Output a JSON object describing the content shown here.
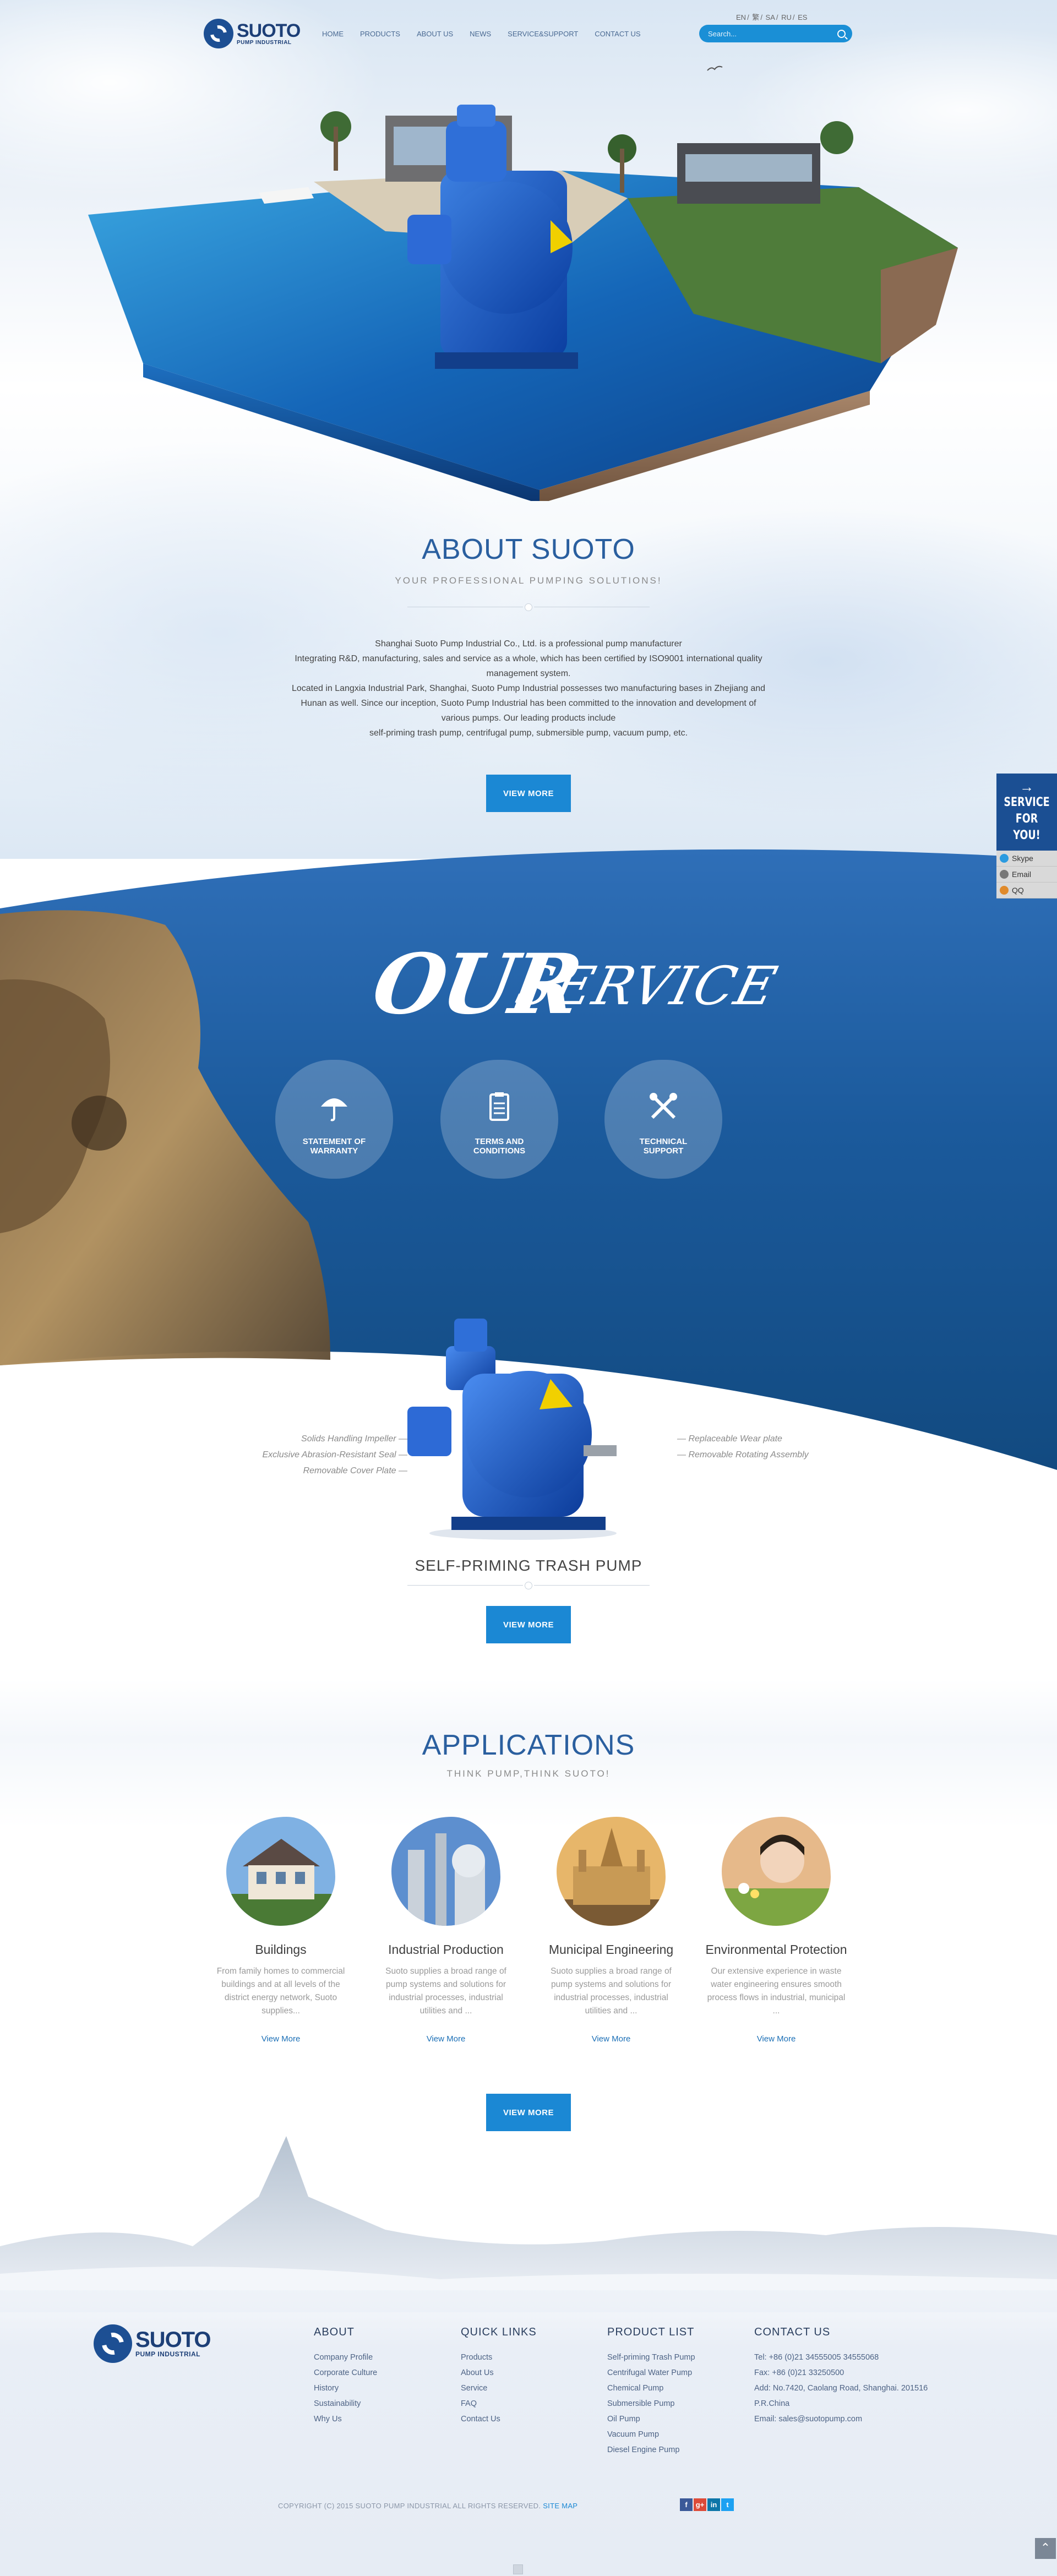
{
  "header": {
    "logo_main": "SUOTO",
    "logo_sub": "PUMP INDUSTRIAL",
    "nav": [
      "HOME",
      "PRODUCTS",
      "ABOUT US",
      "NEWS",
      "SERVICE&SUPPORT",
      "CONTACT US"
    ],
    "languages": [
      "EN",
      "繁",
      "SA",
      "RU",
      "ES"
    ],
    "search_placeholder": "Search..."
  },
  "about": {
    "title": "ABOUT SUOTO",
    "subtitle": "YOUR PROFESSIONAL PUMPING SOLUTIONS!",
    "lines": [
      "Shanghai Suoto Pump Industrial Co., Ltd. is a professional pump manufacturer",
      "Integrating R&D, manufacturing, sales and service as a whole, which has been certified by ISO9001 international quality",
      "management system.",
      "Located in Langxia Industrial Park, Shanghai, Suoto Pump Industrial possesses two manufacturing bases in Zhejiang and",
      "Hunan as well. Since our inception, Suoto Pump Industrial has been committed to the innovation and development of",
      "various pumps. Our leading products include",
      "self-priming trash pump, centrifugal pump, submersible pump,  vacuum pump, etc."
    ],
    "button": "VIEW MORE"
  },
  "service": {
    "title_our": "OUR",
    "title_service": "SERVICE",
    "items": [
      {
        "icon": "umbrella-icon",
        "line1": "STATEMENT OF",
        "line2": "WARRANTY"
      },
      {
        "icon": "clipboard-icon",
        "line1": "TERMS AND",
        "line2": "CONDITIONS"
      },
      {
        "icon": "tools-icon",
        "line1": "TECHNICAL",
        "line2": "SUPPORT"
      }
    ]
  },
  "side_panel": {
    "arrow": "→",
    "line1": "SERVICE",
    "line2": "FOR YOU!",
    "items": [
      {
        "label": "Skype",
        "icon": "skype-icon",
        "color": "#2b9be0"
      },
      {
        "label": "Email",
        "icon": "email-icon",
        "color": "#777777"
      },
      {
        "label": "QQ",
        "icon": "qq-icon",
        "color": "#e08a2b"
      }
    ]
  },
  "product": {
    "features_left": [
      "Solids Handling Impeller",
      "Exclusive Abrasion-Resistant Seal",
      "Removable Cover Plate"
    ],
    "features_right": [
      "Replaceable Wear plate",
      "Removable Rotating Assembly"
    ],
    "title": "SELF-PRIMING TRASH PUMP",
    "button": "VIEW MORE"
  },
  "applications": {
    "title": "APPLICATIONS",
    "subtitle": "THINK PUMP,THINK SUOTO!",
    "items": [
      {
        "name": "Buildings",
        "desc": [
          "From family homes to commercial",
          "buildings and at all levels of the",
          "district energy network, Suoto",
          "supplies..."
        ],
        "more": "View More"
      },
      {
        "name": "Industrial Production",
        "desc": [
          "Suoto supplies a broad range of",
          "pump systems and solutions for",
          "industrial processes, industrial",
          "utilities and ..."
        ],
        "more": "View More"
      },
      {
        "name": "Municipal Engineering",
        "desc": [
          "Suoto supplies a broad range of",
          "pump systems and solutions for",
          "industrial processes, industrial",
          "utilities and ..."
        ],
        "more": "View More"
      },
      {
        "name": "Environmental Protection",
        "desc": [
          "Our extensive experience in waste",
          "water engineering ensures smooth",
          "process flows in industrial, municipal",
          "..."
        ],
        "more": "View More"
      }
    ],
    "button": "VIEW MORE"
  },
  "footer": {
    "logo_main": "SUOTO",
    "logo_sub": "PUMP INDUSTRIAL",
    "about": {
      "heading": "ABOUT",
      "items": [
        "Company Profile",
        "Corporate Culture",
        "History",
        "Sustainability",
        "Why Us"
      ]
    },
    "quick_links": {
      "heading": "QUICK LINKS",
      "items": [
        "Products",
        "About Us",
        "Service",
        "FAQ",
        "Contact Us"
      ]
    },
    "product_list": {
      "heading": "PRODUCT LIST",
      "items": [
        "Self-priming Trash Pump",
        "Centrifugal Water Pump",
        "Chemical Pump",
        "Submersible Pump",
        "Oil Pump",
        "Vacuum Pump",
        "Diesel Engine Pump"
      ]
    },
    "contact": {
      "heading": "CONTACT US",
      "items": [
        "Tel: +86 (0)21 34555005 34555068",
        "Fax: +86 (0)21 33250500",
        "Add: No.7420, Caolang Road, Shanghai. 201516",
        "P.R.China",
        "Email: sales@suotopump.com"
      ]
    },
    "copyright": "COPYRIGHT  (C)  2015 SUOTO PUMP INDUSTRIAL ALL RIGHTS RESERVED.",
    "sitemap": "SITE MAP",
    "social": [
      {
        "label": "f",
        "icon": "facebook-icon",
        "color": "#3b5998"
      },
      {
        "label": "g+",
        "icon": "google-plus-icon",
        "color": "#dd4b39"
      },
      {
        "label": "in",
        "icon": "linkedin-icon",
        "color": "#0e76a8"
      },
      {
        "label": "t",
        "icon": "twitter-icon",
        "color": "#1da1f2"
      }
    ],
    "to_top": "⌃"
  }
}
